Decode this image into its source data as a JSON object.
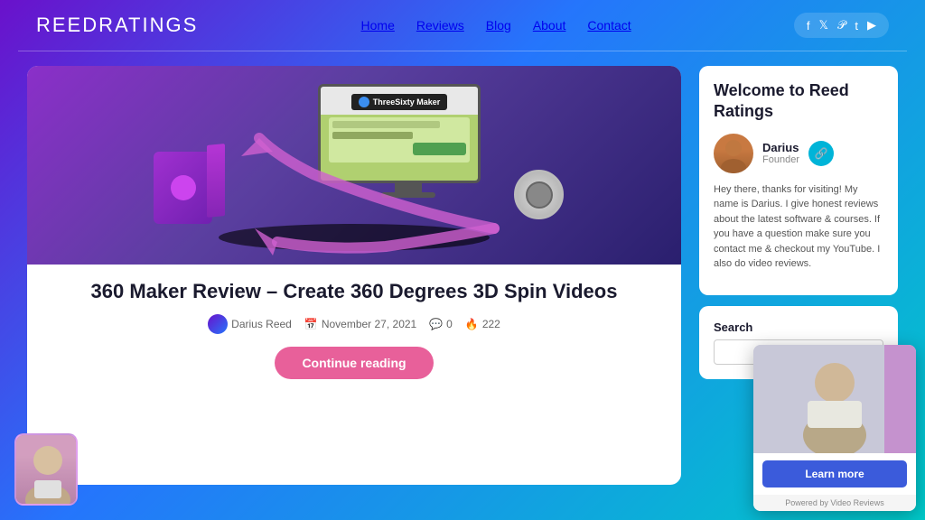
{
  "header": {
    "logo": "ReedRatings",
    "nav": {
      "items": [
        {
          "label": "Home",
          "active": true
        },
        {
          "label": "Reviews",
          "active": false
        },
        {
          "label": "Blog",
          "active": false
        },
        {
          "label": "About",
          "active": false
        },
        {
          "label": "Contact",
          "active": false
        }
      ]
    },
    "social": {
      "icons": [
        "f",
        "t",
        "p",
        "T",
        "▶"
      ]
    }
  },
  "article": {
    "title": "360 Maker Review – Create 360 Degrees 3D Spin Videos",
    "author": "Darius Reed",
    "date": "November 27, 2021",
    "comments": "0",
    "views": "222",
    "continue_label": "Continue reading",
    "image_alt": "360 Maker product image with monitor and camera"
  },
  "sidebar": {
    "welcome_title": "Welcome to Reed Ratings",
    "author_name": "Darius",
    "author_role": "Founder",
    "description": "Hey there, thanks for visiting! My name is Darius. I give honest reviews about the latest software & courses. If you have a question make sure you contact me & checkout my YouTube. I also do video reviews.",
    "search_label": "Search",
    "search_placeholder": ""
  },
  "video_widget": {
    "learn_more_label": "Learn more",
    "powered_by": "Powered by Video Reviews"
  }
}
